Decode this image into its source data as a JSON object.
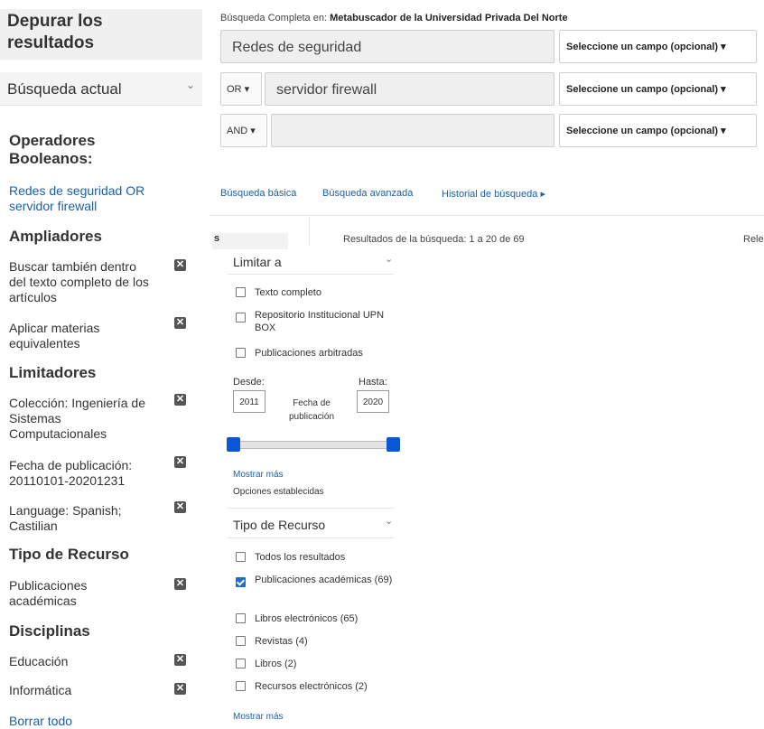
{
  "sidebar": {
    "title_line1": "Depurar los",
    "title_line2": "resultados",
    "current_search": "Búsqueda actual",
    "sections": {
      "boolean": "Operadores Booleanos:",
      "boolean_query": "Redes de seguridad OR servidor firewall",
      "expanders": "Ampliadores",
      "limiters": "Limitadores",
      "resource_type": "Tipo de Recurso",
      "disciplines": "Disciplinas"
    },
    "items": {
      "expander1": "Buscar también dentro del texto completo de los artículos",
      "expander2": "Aplicar materias equivalentes",
      "limiter1": "Colección: Ingeniería de Sistemas Computacionales",
      "limiter2": "Fecha de publicación: 20110101-20201231",
      "limiter3": "Language: Spanish; Castilian",
      "resource1": "Publicaciones académicas",
      "discipline1": "Educación",
      "discipline2": "Informática"
    },
    "clear_all": "Borrar todo"
  },
  "search": {
    "full_label_prefix": "Búsqueda Completa en:",
    "full_label_target": "Metabuscador de la Universidad Privada Del Norte",
    "rows": [
      {
        "op": "",
        "value": "Redes de seguridad",
        "field": "Seleccione un campo (opcional)"
      },
      {
        "op": "OR",
        "value": "servidor firewall",
        "field": "Seleccione un campo (opcional)"
      },
      {
        "op": "AND",
        "value": "",
        "field": "Seleccione un campo (opcional)"
      }
    ],
    "links": {
      "basic": "Búsqueda básica",
      "advanced": "Búsqueda avanzada",
      "history": "Historial de búsqueda"
    }
  },
  "results": {
    "summary": "Resultados de la búsqueda: 1 a 20 de 69",
    "sort_fragment": "Rele",
    "left_fragment": "s"
  },
  "limit_panel": {
    "header": "Limitar a",
    "options": [
      {
        "label": "Texto completo",
        "checked": false
      },
      {
        "label": "Repositorio Institucional UPN BOX",
        "checked": false
      },
      {
        "label": "Publicaciones arbitradas",
        "checked": false
      }
    ],
    "from_label": "Desde:",
    "to_label": "Hasta:",
    "from_year": "2011",
    "to_year": "2020",
    "date_caption": "Fecha de publicación",
    "show_more": "Mostrar más",
    "set_options": "Opciones establecidas"
  },
  "resource_panel": {
    "header": "Tipo de Recurso",
    "options": [
      {
        "label": "Todos los resultados",
        "checked": false
      },
      {
        "label": "Publicaciones académicas (69)",
        "checked": true
      },
      {
        "label": "Libros electrónicos (65)",
        "checked": false
      },
      {
        "label": "Revistas (4)",
        "checked": false
      },
      {
        "label": "Libros (2)",
        "checked": false
      },
      {
        "label": "Recursos electrónicos (2)",
        "checked": false
      }
    ],
    "show_more": "Mostrar más"
  },
  "colors": {
    "link": "#1a5fa8",
    "slider_handle": "#0a57d6",
    "checkbox_checked": "#1a6fd1"
  }
}
